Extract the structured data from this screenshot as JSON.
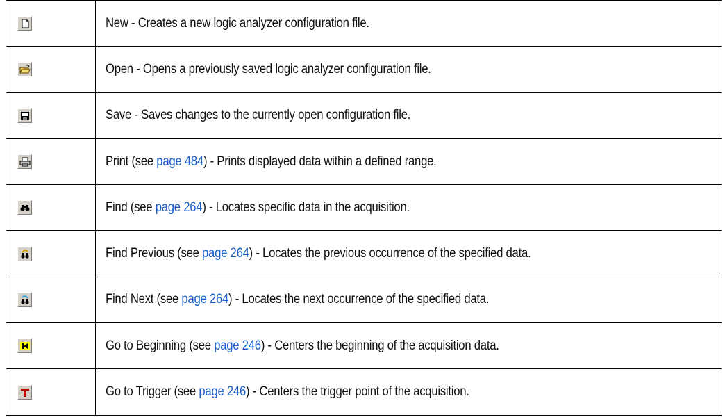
{
  "rows": [
    {
      "icon": "new-file-icon",
      "name": "New",
      "see_text": "",
      "page": "",
      "desc": " - Creates a new logic analyzer configuration file."
    },
    {
      "icon": "open-folder-icon",
      "name": "Open",
      "see_text": "",
      "page": "",
      "desc": " - Opens a previously saved logic analyzer configuration file."
    },
    {
      "icon": "save-disk-icon",
      "name": "Save",
      "see_text": "",
      "page": "",
      "desc": " - Saves changes to the currently open configuration file."
    },
    {
      "icon": "printer-icon",
      "name": "Print",
      "see_text": " (see ",
      "page": "page 484",
      "desc": ") - Prints displayed data within a defined range."
    },
    {
      "icon": "binoculars-icon",
      "name": "Find",
      "see_text": " (see ",
      "page": "page 264",
      "desc": ") - Locates specific data in the acquisition."
    },
    {
      "icon": "find-previous-icon",
      "name": "Find Previous",
      "see_text": " (see ",
      "page": "page 264",
      "desc": ") - Locates the previous occurrence of the specified data."
    },
    {
      "icon": "find-next-icon",
      "name": "Find Next",
      "see_text": " (see ",
      "page": "page 264",
      "desc": ") - Locates the next occurrence of the specified data."
    },
    {
      "icon": "go-to-beginning-icon",
      "name": "Go to Beginning",
      "see_text": " (see ",
      "page": "page 246",
      "desc": ") - Centers the beginning of the acquisition data."
    },
    {
      "icon": "go-to-trigger-icon",
      "name": "Go to Trigger",
      "see_text": " (see ",
      "page": "page 246",
      "desc": ") - Centers the trigger point of the acquisition."
    }
  ],
  "colors": {
    "link": "#1a5fc8",
    "button_face": "#d4d0c8",
    "trigger_red": "#c00000",
    "highlight_yellow": "#ffff00"
  }
}
